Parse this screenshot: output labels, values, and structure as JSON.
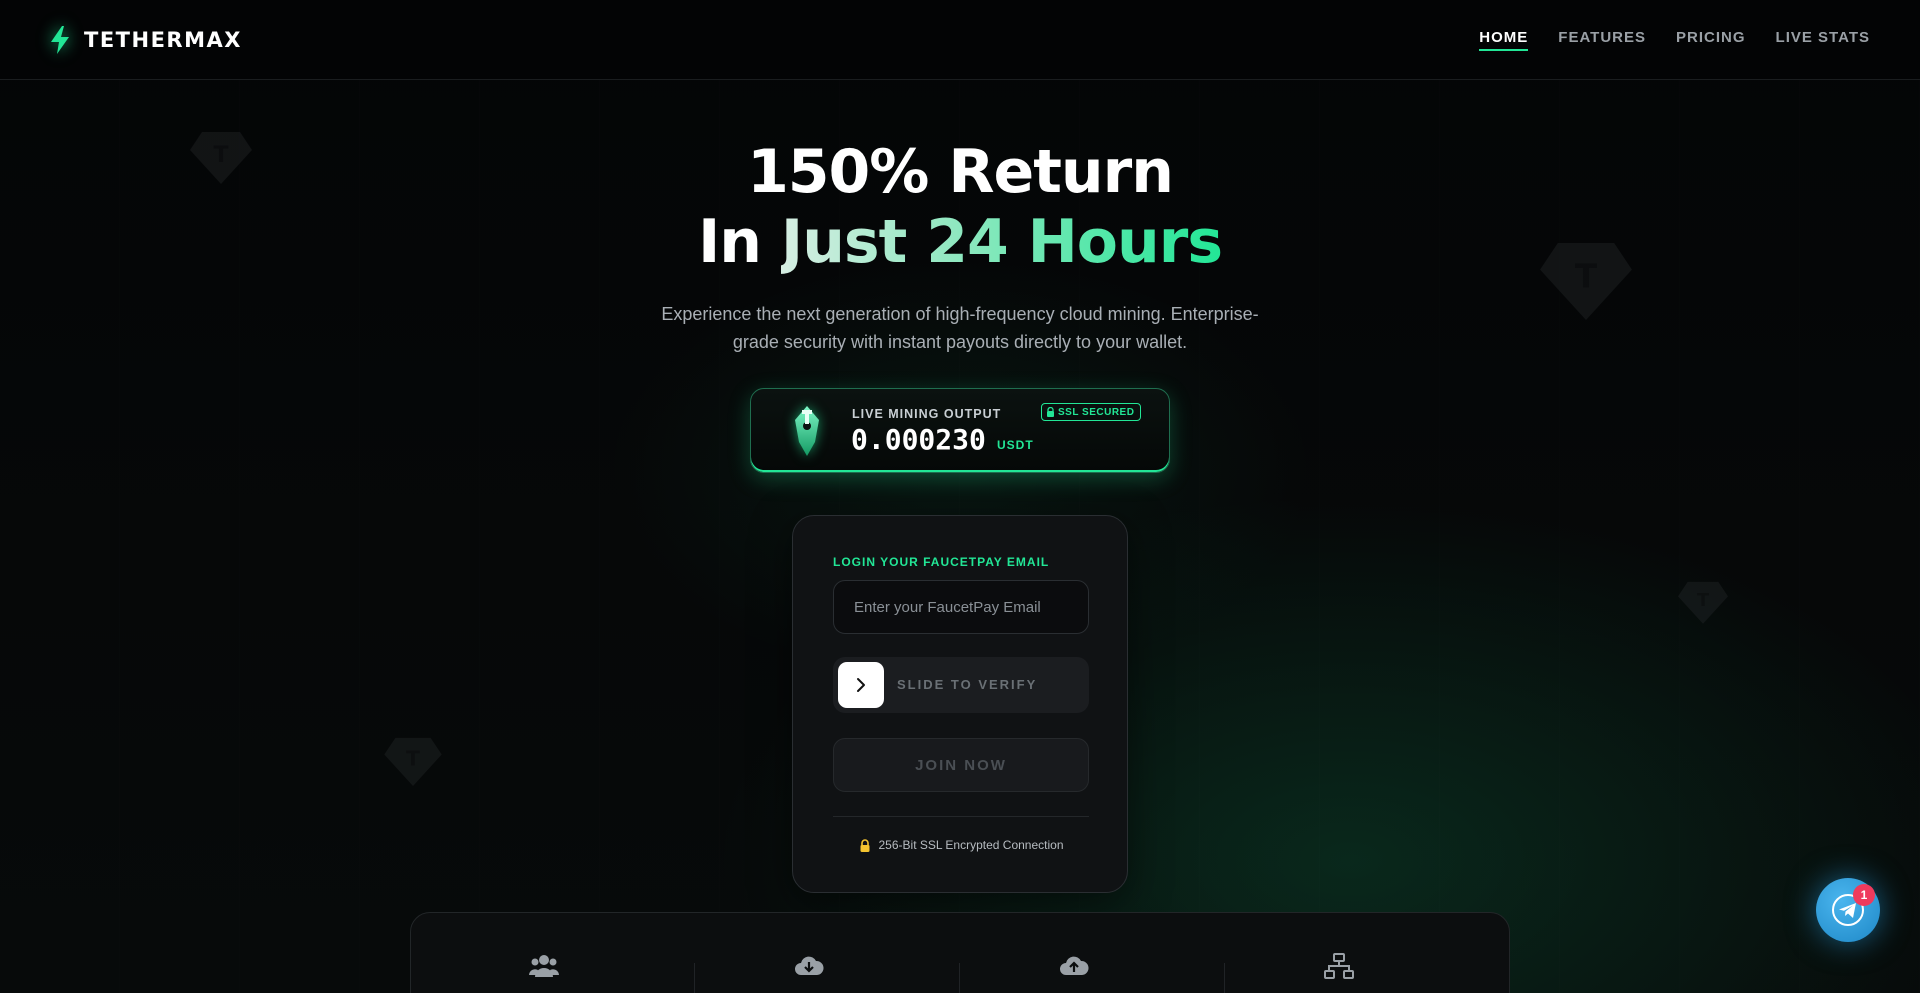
{
  "nav": {
    "brand": "TETHERMAX",
    "links": [
      {
        "label": "HOME",
        "active": true
      },
      {
        "label": "FEATURES",
        "active": false
      },
      {
        "label": "PRICING",
        "active": false
      },
      {
        "label": "LIVE STATS",
        "active": false
      }
    ]
  },
  "hero": {
    "title_line1": "150% Return",
    "title_line2_plain": "In ",
    "title_line2_gradient": "Just 24 Hours",
    "subtitle": "Experience the next generation of high-frequency cloud mining. Enterprise-grade security with instant payouts directly to your wallet."
  },
  "mining": {
    "label": "LIVE MINING OUTPUT",
    "badge": "SSL SECURED",
    "value": "0.000230",
    "unit": "USDT"
  },
  "login": {
    "label": "LOGIN YOUR FAUCETPAY EMAIL",
    "email_placeholder": "Enter your FaucetPay Email",
    "email_value": "",
    "slider_text": "SLIDE TO VERIFY",
    "join_label": "JOIN NOW",
    "secure_text": "256-Bit SSL Encrypted Connection"
  },
  "stats": {
    "icons": [
      "users-icon",
      "cloud-download-icon",
      "cloud-upload-icon",
      "network-icon"
    ]
  },
  "telegram": {
    "badge_count": "1"
  },
  "colors": {
    "accent": "#22e696",
    "background": "#050607",
    "card": "#101214",
    "telegram": "#2aa3e0",
    "badge": "#ef3a5d"
  }
}
